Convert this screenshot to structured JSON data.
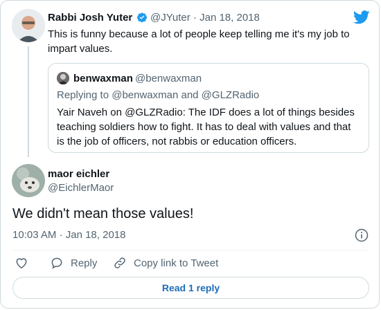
{
  "parent_tweet": {
    "author_name": "Rabbi Josh Yuter",
    "handle": "@JYuter",
    "separator": "·",
    "date": "Jan 18, 2018",
    "text_line1": "This is funny because a lot of people keep telling me it's my job to",
    "text_line2": "impart values."
  },
  "quoted_tweet": {
    "author_name": "benwaxman",
    "handle": "@benwaxman",
    "replying_to": "Replying to @benwaxman and @GLZRadio",
    "line1": "Yair Naveh on @GLZRadio:  The IDF does a lot of things besides",
    "line2": "teaching soldiers how to fight.  It has to deal with values and that",
    "line3": "is the job of officers, not rabbis or education officers."
  },
  "main_tweet": {
    "author_name": "maor eichler",
    "handle": "@EichlerMaor",
    "text": "We didn't mean those values!",
    "time": "10:03 AM",
    "separator": "·",
    "date": "Jan 18, 2018"
  },
  "actions": {
    "reply_label": "Reply",
    "copy_link_label": "Copy link to Tweet",
    "read_replies_label": "Read 1 reply"
  },
  "colors": {
    "brand_blue": "#1d9bf0",
    "link_blue": "#1d6cb8",
    "border": "#cfd9de",
    "muted_text": "#536471"
  },
  "icons": [
    "verified-badge-icon",
    "twitter-bird-icon",
    "info-icon",
    "heart-icon",
    "reply-icon",
    "link-icon"
  ]
}
